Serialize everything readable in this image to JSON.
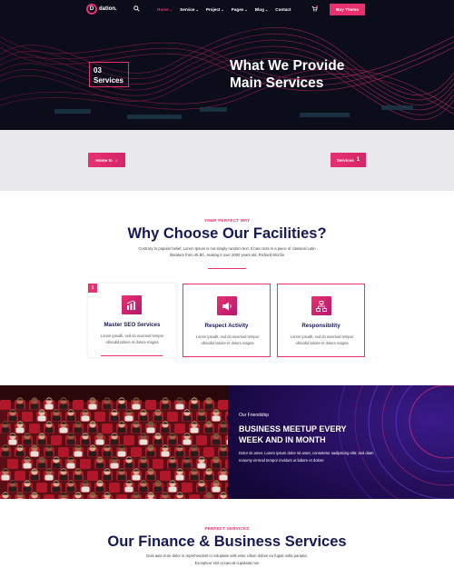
{
  "header": {
    "logo_initial": "D",
    "logo_text": "dation.",
    "menu": [
      {
        "label": "Home",
        "active": true,
        "caret": true
      },
      {
        "label": "Service",
        "active": false,
        "caret": true
      },
      {
        "label": "Project",
        "active": false,
        "caret": true
      },
      {
        "label": "Pages",
        "active": false,
        "caret": true
      },
      {
        "label": "Blog",
        "active": false,
        "caret": true
      },
      {
        "label": "Contact",
        "active": false,
        "caret": false
      }
    ],
    "cart_count": "0",
    "buy_label": "Buy Theme"
  },
  "hero": {
    "badge_number": "03",
    "badge_label": "Services",
    "title": "What We Provide Main Services"
  },
  "breadcrumb": {
    "home_label": "Home to",
    "services_label": "Services",
    "services_number": "1"
  },
  "why": {
    "kicker": "YOUR PERFECT WAY",
    "title": "Why Choose Our Facilities?",
    "desc": "Contrary to popular belief, Lorem Ipsum is not simply random text. It has roots in a piece of classical Latin literature from 45 BC, making it over 2000 years old. Richard McClin",
    "cards": [
      {
        "number": "1",
        "icon": "analytics-chart-icon",
        "title": "Master SEO Services",
        "text": "Lorem ipsudlt, sed do eiusmod tempor ollncidid labore et dolore magna"
      },
      {
        "number": "",
        "icon": "megaphone-icon",
        "title": "Respect Activity",
        "text": "Lorem ipsudlt, sed do eiusmod tempor ollncidid labore et dolore magna"
      },
      {
        "number": "",
        "icon": "network-hierarchy-icon",
        "title": "Responsibility",
        "text": "Lorem ipsudlt, sed do eiusmod tempor ollncidid labore et dolore magna"
      }
    ]
  },
  "event": {
    "kicker": "Our Friendship",
    "title": "BUSINESS MEETUP EVERY WEEK AND IN MONTH",
    "text": "Dolor sit amet. Lorem ipsum dolor sit amet, consetetur sadipscing elitr, sed diam nonumy eirmod tempor invidunt ut labore et dolore"
  },
  "finance": {
    "kicker": "PERFECT SERVICES",
    "title": "Our Finance & Business Services",
    "text": "Duis aute irure dolor in reprehenderit in voluptate velit esse cillum dolore eu fugiat nulla pariatur. Excepteur sint occaecat cupidatat non"
  },
  "colors": {
    "accent": "#e8306f",
    "navy": "#151a55",
    "hero_bg": "#0b0d1a",
    "band_bg": "#e9e9eb"
  }
}
